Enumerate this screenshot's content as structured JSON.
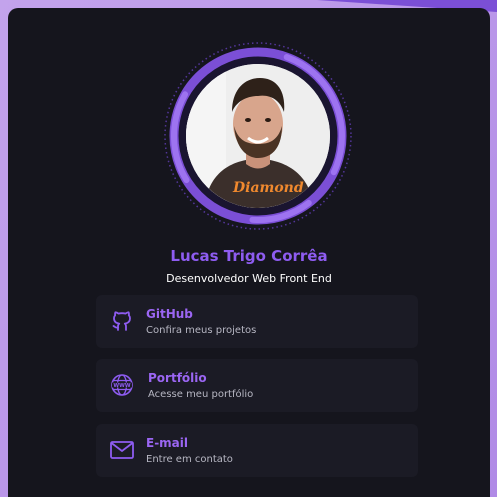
{
  "profile": {
    "name": "Lucas Trigo Corrêa",
    "role": "Desenvolvedor Web Front End",
    "photo_shirt_text": "Diamond"
  },
  "links": [
    {
      "title": "GitHub",
      "subtitle": "Confira meus projetos",
      "icon": "github-icon"
    },
    {
      "title": "Portfólio",
      "subtitle": "Acesse meu portfólio",
      "icon": "globe-www-icon"
    },
    {
      "title": "E-mail",
      "subtitle": "Entre em contato",
      "icon": "mail-icon"
    }
  ],
  "colors": {
    "accent": "#8e5cf1",
    "card": "#15151d",
    "link_bg": "#1b1b25",
    "background": "#c3a3ec"
  }
}
